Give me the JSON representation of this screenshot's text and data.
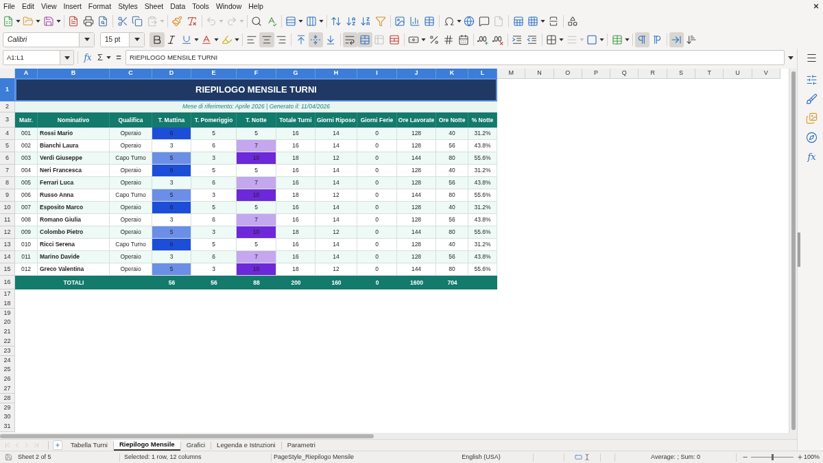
{
  "menu_bar": {
    "items": [
      "File",
      "Edit",
      "View",
      "Insert",
      "Format",
      "Styles",
      "Sheet",
      "Data",
      "Tools",
      "Window",
      "Help"
    ]
  },
  "standard_toolbar": {
    "groups": [
      [
        {
          "kind": "new_spreadsheet",
          "dropdown": true,
          "disabled": false
        },
        {
          "kind": "open",
          "dropdown": true,
          "disabled": false
        },
        {
          "kind": "save",
          "dropdown": true,
          "disabled": false
        }
      ],
      [
        {
          "kind": "export_pdf",
          "dropdown": false,
          "disabled": false
        },
        {
          "kind": "print",
          "dropdown": false,
          "disabled": false
        },
        {
          "kind": "print_preview",
          "dropdown": false,
          "disabled": false
        }
      ],
      [
        {
          "kind": "cut",
          "dropdown": false,
          "disabled": false
        },
        {
          "kind": "copy",
          "dropdown": false,
          "disabled": false
        },
        {
          "kind": "paste",
          "dropdown": true,
          "disabled": true
        }
      ],
      [
        {
          "kind": "clone_formatting",
          "dropdown": false,
          "disabled": false
        },
        {
          "kind": "clear_formatting",
          "dropdown": false,
          "disabled": false
        }
      ],
      [
        {
          "kind": "undo",
          "dropdown": true,
          "disabled": true
        },
        {
          "kind": "redo",
          "dropdown": true,
          "disabled": true
        }
      ],
      [
        {
          "kind": "find_replace",
          "dropdown": false,
          "disabled": false
        },
        {
          "kind": "spelling",
          "dropdown": false,
          "disabled": false
        }
      ],
      [
        {
          "kind": "rows",
          "dropdown": true,
          "disabled": false
        },
        {
          "kind": "columns",
          "dropdown": true,
          "disabled": false
        }
      ],
      [
        {
          "kind": "sort",
          "dropdown": false,
          "disabled": false
        },
        {
          "kind": "sort_ascending",
          "dropdown": false,
          "disabled": false
        },
        {
          "kind": "sort_descending",
          "dropdown": false,
          "disabled": false
        },
        {
          "kind": "autofilter",
          "dropdown": false,
          "disabled": false
        }
      ],
      [
        {
          "kind": "image",
          "dropdown": false,
          "disabled": false
        },
        {
          "kind": "chart",
          "dropdown": false,
          "disabled": false
        },
        {
          "kind": "pivot_table",
          "dropdown": false,
          "disabled": false
        }
      ],
      [
        {
          "kind": "special_character",
          "dropdown": true,
          "disabled": false
        },
        {
          "kind": "hyperlink",
          "dropdown": false,
          "disabled": false
        },
        {
          "kind": "comment",
          "dropdown": false,
          "disabled": false
        },
        {
          "kind": "headers_footers",
          "dropdown": false,
          "disabled": true
        }
      ],
      [
        {
          "kind": "print_area",
          "dropdown": false,
          "disabled": false
        },
        {
          "kind": "freeze",
          "dropdown": true,
          "disabled": false
        },
        {
          "kind": "split_window",
          "dropdown": false,
          "disabled": false
        }
      ],
      [
        {
          "kind": "shapes",
          "dropdown": false,
          "disabled": false
        }
      ]
    ]
  },
  "formatting_toolbar": {
    "font_name": "Calibri",
    "font_size": "15 pt",
    "groups": [
      [
        {
          "kind": "bold",
          "dropdown": false,
          "active": true,
          "disabled": false
        },
        {
          "kind": "italic",
          "dropdown": false,
          "active": false,
          "disabled": false
        },
        {
          "kind": "underline",
          "dropdown": true,
          "active": false,
          "disabled": false
        },
        {
          "kind": "font_color",
          "dropdown": true,
          "active": false,
          "disabled": false
        },
        {
          "kind": "highlight",
          "dropdown": true,
          "active": false,
          "disabled": false
        }
      ],
      [
        {
          "kind": "align_left",
          "dropdown": false,
          "active": false,
          "disabled": false
        },
        {
          "kind": "align_center",
          "dropdown": false,
          "active": true,
          "disabled": false
        },
        {
          "kind": "align_right",
          "dropdown": false,
          "active": false,
          "disabled": false
        }
      ],
      [
        {
          "kind": "align_top",
          "dropdown": false,
          "active": false,
          "disabled": false
        },
        {
          "kind": "align_middle",
          "dropdown": false,
          "active": true,
          "disabled": false
        },
        {
          "kind": "align_bottom",
          "dropdown": false,
          "active": false,
          "disabled": false
        }
      ],
      [
        {
          "kind": "wrap_text",
          "dropdown": false,
          "active": true,
          "disabled": false
        },
        {
          "kind": "merge_center",
          "dropdown": false,
          "active": true,
          "disabled": false
        },
        {
          "kind": "merge_cells",
          "dropdown": false,
          "active": false,
          "disabled": true
        },
        {
          "kind": "unmerge",
          "dropdown": false,
          "active": false,
          "disabled": false
        }
      ],
      [
        {
          "kind": "currency",
          "dropdown": true,
          "active": false,
          "disabled": false
        },
        {
          "kind": "percent",
          "dropdown": false,
          "active": false,
          "disabled": false
        },
        {
          "kind": "number",
          "dropdown": false,
          "active": false,
          "disabled": false
        },
        {
          "kind": "date",
          "dropdown": false,
          "active": false,
          "disabled": false
        }
      ],
      [
        {
          "kind": "add_decimal",
          "dropdown": false,
          "active": false,
          "disabled": false
        },
        {
          "kind": "delete_decimal",
          "dropdown": false,
          "active": false,
          "disabled": false
        }
      ],
      [
        {
          "kind": "increase_indent",
          "dropdown": false,
          "active": false,
          "disabled": false
        },
        {
          "kind": "decrease_indent",
          "dropdown": false,
          "active": false,
          "disabled": false
        }
      ],
      [
        {
          "kind": "borders",
          "dropdown": true,
          "active": false,
          "disabled": false
        },
        {
          "kind": "border_style",
          "dropdown": true,
          "active": false,
          "disabled": true
        },
        {
          "kind": "border_color",
          "dropdown": true,
          "active": false,
          "disabled": false
        }
      ],
      [
        {
          "kind": "conditional",
          "dropdown": true,
          "active": false,
          "disabled": false
        }
      ],
      [
        {
          "kind": "left_to_right",
          "dropdown": false,
          "active": true,
          "disabled": false
        },
        {
          "kind": "right_to_left",
          "dropdown": false,
          "active": false,
          "disabled": false
        }
      ],
      [
        {
          "kind": "text_direction",
          "dropdown": false,
          "active": true,
          "disabled": false
        },
        {
          "kind": "vertical_text",
          "dropdown": false,
          "active": false,
          "disabled": false
        }
      ]
    ]
  },
  "formula_bar": {
    "name_box": "A1:L1",
    "function_wizard": "fx",
    "sum": "Σ",
    "formula": "=",
    "content": "RIEPILOGO MENSILE TURNI"
  },
  "sheet": {
    "column_headers": [
      {
        "label": "A",
        "selected": true
      },
      {
        "label": "B",
        "selected": true
      },
      {
        "label": "C",
        "selected": true
      },
      {
        "label": "D",
        "selected": true
      },
      {
        "label": "E",
        "selected": true
      },
      {
        "label": "F",
        "selected": true
      },
      {
        "label": "G",
        "selected": true
      },
      {
        "label": "H",
        "selected": true
      },
      {
        "label": "I",
        "selected": true
      },
      {
        "label": "J",
        "selected": true
      },
      {
        "label": "K",
        "selected": true
      },
      {
        "label": "L",
        "selected": true
      },
      {
        "label": "M",
        "selected": false
      },
      {
        "label": "N",
        "selected": false
      },
      {
        "label": "O",
        "selected": false
      },
      {
        "label": "P",
        "selected": false
      },
      {
        "label": "Q",
        "selected": false
      },
      {
        "label": "R",
        "selected": false
      },
      {
        "label": "S",
        "selected": false
      },
      {
        "label": "T",
        "selected": false
      },
      {
        "label": "U",
        "selected": false
      },
      {
        "label": "V",
        "selected": false
      }
    ],
    "row_headers": [
      {
        "label": "1",
        "selected": true
      },
      {
        "label": "2",
        "selected": false
      },
      {
        "label": "3",
        "selected": false
      },
      {
        "label": "4",
        "selected": false
      },
      {
        "label": "5",
        "selected": false
      },
      {
        "label": "6",
        "selected": false
      },
      {
        "label": "7",
        "selected": false
      },
      {
        "label": "8",
        "selected": false
      },
      {
        "label": "9",
        "selected": false
      },
      {
        "label": "10",
        "selected": false
      },
      {
        "label": "11",
        "selected": false
      },
      {
        "label": "12",
        "selected": false
      },
      {
        "label": "13",
        "selected": false
      },
      {
        "label": "14",
        "selected": false
      },
      {
        "label": "15",
        "selected": false
      },
      {
        "label": "16",
        "selected": false
      },
      {
        "label": "17",
        "selected": false
      },
      {
        "label": "18",
        "selected": false
      },
      {
        "label": "19",
        "selected": false
      },
      {
        "label": "20",
        "selected": false
      },
      {
        "label": "21",
        "selected": false
      },
      {
        "label": "22",
        "selected": false
      },
      {
        "label": "23",
        "selected": false
      },
      {
        "label": "24",
        "selected": false
      },
      {
        "label": "25",
        "selected": false
      },
      {
        "label": "26",
        "selected": false
      },
      {
        "label": "27",
        "selected": false
      },
      {
        "label": "28",
        "selected": false
      },
      {
        "label": "29",
        "selected": false
      },
      {
        "label": "30",
        "selected": false
      },
      {
        "label": "31",
        "selected": false
      }
    ],
    "title": {
      "text": "RIEPILOGO MENSILE TURNI",
      "selected": true
    },
    "subtitle": "Mese di riferimento: Aprile 2026 | Generato il: 11/04/2026",
    "table": {
      "columns": [
        "Matr.",
        "Nominativo",
        "Qualifica",
        "T. Mattina",
        "T. Pomeriggio",
        "T. Notte",
        "Totale Turni",
        "Giorni Riposo",
        "Giorni Ferie",
        "Ore Lavorate",
        "Ore Notte",
        "% Notte"
      ],
      "rows": [
        {
          "cells": [
            {
              "text": "001"
            },
            {
              "text": "Rossi Mario"
            },
            {
              "text": "Operaio"
            },
            {
              "text": "6",
              "color": "#1d4ed8"
            },
            {
              "text": "5"
            },
            {
              "text": "5"
            },
            {
              "text": "16"
            },
            {
              "text": "14"
            },
            {
              "text": "0"
            },
            {
              "text": "128"
            },
            {
              "text": "40"
            },
            {
              "text": "31.2%"
            }
          ]
        },
        {
          "cells": [
            {
              "text": "002"
            },
            {
              "text": "Bianchi Laura"
            },
            {
              "text": "Operaio"
            },
            {
              "text": "3"
            },
            {
              "text": "6"
            },
            {
              "text": "7",
              "color": "#c4a7ef"
            },
            {
              "text": "16"
            },
            {
              "text": "14"
            },
            {
              "text": "0"
            },
            {
              "text": "128"
            },
            {
              "text": "56"
            },
            {
              "text": "43.8%"
            }
          ]
        },
        {
          "cells": [
            {
              "text": "003"
            },
            {
              "text": "Verdi Giuseppe"
            },
            {
              "text": "Capo Turno"
            },
            {
              "text": "5",
              "color": "#6b8fe6"
            },
            {
              "text": "3"
            },
            {
              "text": "10",
              "color": "#6d28d9"
            },
            {
              "text": "18"
            },
            {
              "text": "12"
            },
            {
              "text": "0"
            },
            {
              "text": "144"
            },
            {
              "text": "80"
            },
            {
              "text": "55.6%"
            }
          ]
        },
        {
          "cells": [
            {
              "text": "004"
            },
            {
              "text": "Neri Francesca"
            },
            {
              "text": "Operaio"
            },
            {
              "text": "6",
              "color": "#1d4ed8"
            },
            {
              "text": "5"
            },
            {
              "text": "5"
            },
            {
              "text": "16"
            },
            {
              "text": "14"
            },
            {
              "text": "0"
            },
            {
              "text": "128"
            },
            {
              "text": "40"
            },
            {
              "text": "31.2%"
            }
          ]
        },
        {
          "cells": [
            {
              "text": "005"
            },
            {
              "text": "Ferrari Luca"
            },
            {
              "text": "Operaio"
            },
            {
              "text": "3"
            },
            {
              "text": "6"
            },
            {
              "text": "7",
              "color": "#c4a7ef"
            },
            {
              "text": "16"
            },
            {
              "text": "14"
            },
            {
              "text": "0"
            },
            {
              "text": "128"
            },
            {
              "text": "56"
            },
            {
              "text": "43.8%"
            }
          ]
        },
        {
          "cells": [
            {
              "text": "006"
            },
            {
              "text": "Russo Anna"
            },
            {
              "text": "Capo Turno"
            },
            {
              "text": "5",
              "color": "#6b8fe6"
            },
            {
              "text": "3"
            },
            {
              "text": "10",
              "color": "#6d28d9"
            },
            {
              "text": "18"
            },
            {
              "text": "12"
            },
            {
              "text": "0"
            },
            {
              "text": "144"
            },
            {
              "text": "80"
            },
            {
              "text": "55.6%"
            }
          ]
        },
        {
          "cells": [
            {
              "text": "007"
            },
            {
              "text": "Esposito Marco"
            },
            {
              "text": "Operaio"
            },
            {
              "text": "6",
              "color": "#1d4ed8"
            },
            {
              "text": "5"
            },
            {
              "text": "5"
            },
            {
              "text": "16"
            },
            {
              "text": "14"
            },
            {
              "text": "0"
            },
            {
              "text": "128"
            },
            {
              "text": "40"
            },
            {
              "text": "31.2%"
            }
          ]
        },
        {
          "cells": [
            {
              "text": "008"
            },
            {
              "text": "Romano Giulia"
            },
            {
              "text": "Operaio"
            },
            {
              "text": "3"
            },
            {
              "text": "6"
            },
            {
              "text": "7",
              "color": "#c4a7ef"
            },
            {
              "text": "16"
            },
            {
              "text": "14"
            },
            {
              "text": "0"
            },
            {
              "text": "128"
            },
            {
              "text": "56"
            },
            {
              "text": "43.8%"
            }
          ]
        },
        {
          "cells": [
            {
              "text": "009"
            },
            {
              "text": "Colombo Pietro"
            },
            {
              "text": "Operaio"
            },
            {
              "text": "5",
              "color": "#6b8fe6"
            },
            {
              "text": "3"
            },
            {
              "text": "10",
              "color": "#6d28d9"
            },
            {
              "text": "18"
            },
            {
              "text": "12"
            },
            {
              "text": "0"
            },
            {
              "text": "144"
            },
            {
              "text": "80"
            },
            {
              "text": "55.6%"
            }
          ]
        },
        {
          "cells": [
            {
              "text": "010"
            },
            {
              "text": "Ricci Serena"
            },
            {
              "text": "Capo Turno"
            },
            {
              "text": "6",
              "color": "#1d4ed8"
            },
            {
              "text": "5"
            },
            {
              "text": "5"
            },
            {
              "text": "16"
            },
            {
              "text": "14"
            },
            {
              "text": "0"
            },
            {
              "text": "128"
            },
            {
              "text": "40"
            },
            {
              "text": "31.2%"
            }
          ]
        },
        {
          "cells": [
            {
              "text": "011"
            },
            {
              "text": "Marino Davide"
            },
            {
              "text": "Operaio"
            },
            {
              "text": "3"
            },
            {
              "text": "6"
            },
            {
              "text": "7",
              "color": "#c4a7ef"
            },
            {
              "text": "16"
            },
            {
              "text": "14"
            },
            {
              "text": "0"
            },
            {
              "text": "128"
            },
            {
              "text": "56"
            },
            {
              "text": "43.8%"
            }
          ]
        },
        {
          "cells": [
            {
              "text": "012"
            },
            {
              "text": "Greco Valentina"
            },
            {
              "text": "Operaio"
            },
            {
              "text": "5",
              "color": "#6b8fe6"
            },
            {
              "text": "3"
            },
            {
              "text": "10",
              "color": "#6d28d9"
            },
            {
              "text": "18"
            },
            {
              "text": "12"
            },
            {
              "text": "0"
            },
            {
              "text": "144"
            },
            {
              "text": "80"
            },
            {
              "text": "55.6%"
            }
          ]
        }
      ],
      "totals": {
        "label": "TOTALI",
        "values": [
          "56",
          "56",
          "88",
          "200",
          "160",
          "0",
          "1600",
          "704"
        ]
      }
    }
  },
  "sheet_tabs": {
    "navigation": [
      {
        "kind": "first",
        "disabled": true
      },
      {
        "kind": "previous",
        "disabled": true
      },
      {
        "kind": "next",
        "disabled": true
      },
      {
        "kind": "last",
        "disabled": true
      }
    ],
    "tabs": [
      {
        "label": "Tabella Turni",
        "selected": false
      },
      {
        "label": "Riepilogo Mensile",
        "selected": true
      },
      {
        "label": "Grafici",
        "selected": false
      },
      {
        "label": "Legenda e Istruzioni",
        "selected": false
      },
      {
        "label": "Parametri",
        "selected": false
      }
    ]
  },
  "sidebar": {
    "buttons": [
      {
        "kind": "menu"
      },
      {
        "kind": "properties"
      },
      {
        "kind": "styles"
      },
      {
        "kind": "gallery"
      },
      {
        "kind": "navigator"
      },
      {
        "kind": "functions",
        "label": "fx"
      }
    ]
  },
  "status_bar": {
    "sheet": "Sheet 2 of 5",
    "selection": "Selected: 1 row, 12 columns",
    "page_style": "PageStyle_Riepilogo Mensile",
    "language": "English (USA)",
    "summary": "Average: ; Sum: 0",
    "zoom": {
      "level": 0.5,
      "reading": "100%"
    }
  }
}
